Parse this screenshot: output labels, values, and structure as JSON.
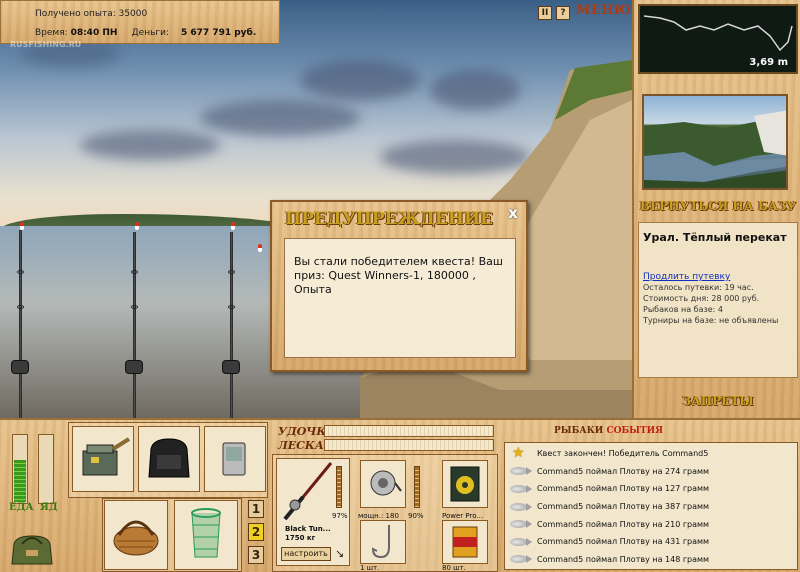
{
  "hud": {
    "exp_received_label": "Получено опыта: 35000",
    "time_label": "Время:",
    "time_value": "08:40 ПН",
    "money_label": "Деньги:",
    "money_value": "5 677 791 руб.",
    "logo_text": "RUSFISHING.RU"
  },
  "menu": {
    "pause_icon_text": "II",
    "help_icon_text": "?",
    "menu_label": "МЕНЮ"
  },
  "depth": {
    "value": "3,69 m"
  },
  "right_panel": {
    "back_to_base_label": "ВЕРНУТЬСЯ НА БАЗУ",
    "location_name": "Урал. Тёплый перекат",
    "extend_trip_link": "Продлить путевку",
    "trip_left": "Осталось путевки: 19 час.",
    "day_cost": "Стоимость дня: 28 000 руб.",
    "anglers_on_base": "Рыбаков на базе: 4",
    "tournaments": "Турниры на базе: не объявлены",
    "bans_label": "ЗАПРЕТЫ"
  },
  "dialog": {
    "title": "ПРЕДУПРЕЖДЕНИЕ",
    "close_icon_text": "x",
    "message": "Вы стали победителем квеста! Ваш приз: Quest Winners-1, 180000 , Опыта"
  },
  "bottom": {
    "food_label": "ЕДА",
    "drink_label": "ЯД",
    "rod_bar_label": "УДОЧКА",
    "line_bar_label": "ЛЕСКА",
    "slot_numbers": [
      "1",
      "2",
      "3"
    ],
    "active_slot": "2",
    "food_level": 0.62,
    "drink_level": 0.0,
    "rod": {
      "name": "Black Tun...",
      "weight": "1750 кг",
      "wear": "97%",
      "setup_button": "настроить"
    },
    "reel": {
      "power": "мощн.: 180",
      "wear": "90%"
    },
    "line": {
      "name": "Power Pro..."
    },
    "hook": {
      "count": "1 шт."
    },
    "bait": {
      "count": "80 шт."
    }
  },
  "events": {
    "tab_anglers": "РЫБАКИ",
    "tab_events": "СОБЫТИЯ",
    "items": [
      {
        "icon": "star-icon",
        "text": "Квест закончен! Победитель Command5"
      },
      {
        "icon": "fish-icon",
        "text": "Command5 поймал Плотву на 274 грамм"
      },
      {
        "icon": "fish-icon",
        "text": "Command5 поймал Плотву на 127 грамм"
      },
      {
        "icon": "fish-icon",
        "text": "Command5 поймал Плотву на 387 грамм"
      },
      {
        "icon": "fish-icon",
        "text": "Command5 поймал Плотву на 210 грамм"
      },
      {
        "icon": "fish-icon",
        "text": "Command5 поймал Плотву на 431 грамм"
      },
      {
        "icon": "fish-icon",
        "text": "Command5 поймал Плотву на 148 грамм"
      }
    ]
  },
  "colors": {
    "accent_red": "#b03a10",
    "gold_title": "#c8a020",
    "link_blue": "#1030c0",
    "active_slot": "#f0d020"
  }
}
